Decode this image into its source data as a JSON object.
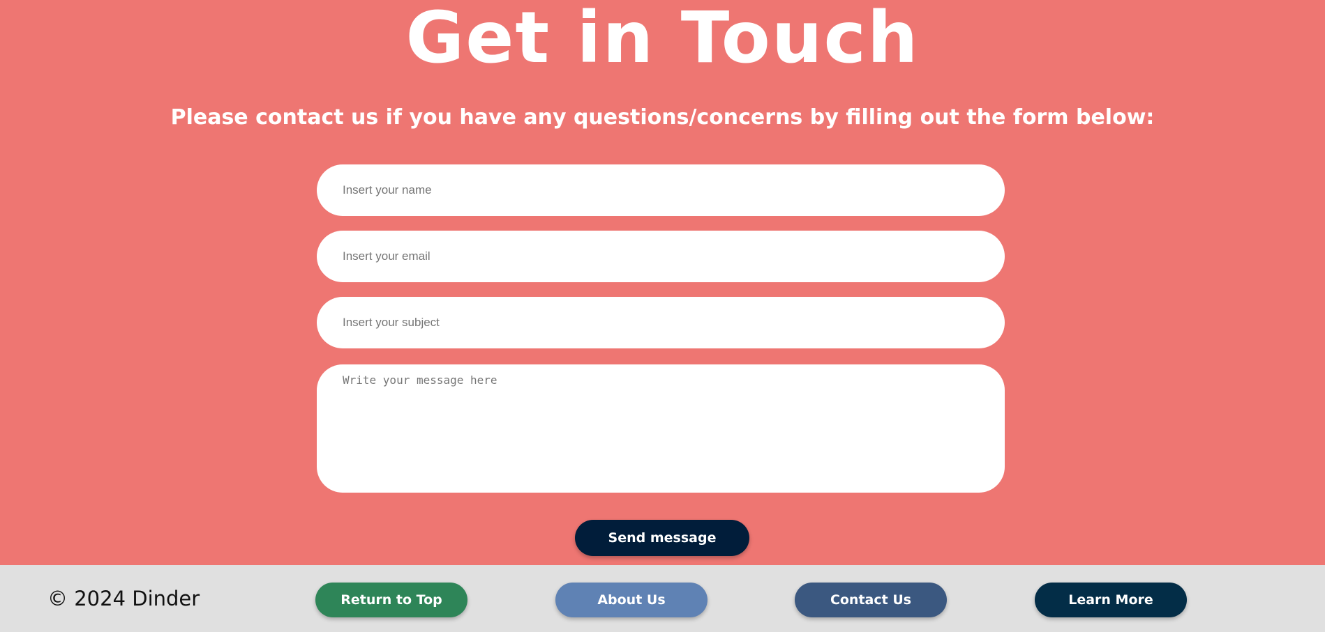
{
  "hero": {
    "title": "Get in Touch",
    "subtitle": "Please contact us if you have any questions/concerns by filling out the form below:"
  },
  "form": {
    "name_placeholder": "Insert your name",
    "email_placeholder": "Insert your email",
    "subject_placeholder": "Insert your subject",
    "message_placeholder": "Write your message here",
    "submit_label": "Send message"
  },
  "footer": {
    "copyright": "© 2024 Dinder",
    "buttons": [
      {
        "label": "Return to Top",
        "color": "#2e8558"
      },
      {
        "label": "About Us",
        "color": "#5f82b4"
      },
      {
        "label": "Contact Us",
        "color": "#3b5880"
      },
      {
        "label": "Learn More",
        "color": "#032d47"
      }
    ]
  },
  "colors": {
    "background_main": "#ee7672",
    "background_footer": "#e0e0e0",
    "submit_button": "#011d3a"
  }
}
